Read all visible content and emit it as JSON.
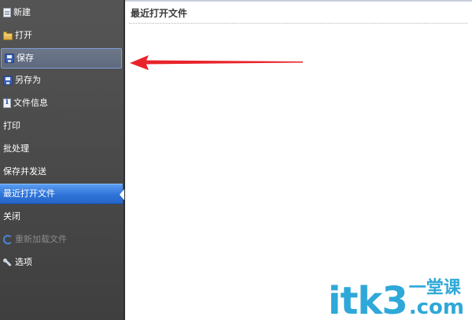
{
  "sidebar": {
    "items": [
      {
        "label": "新建",
        "icon": "new-document-icon",
        "state": "normal"
      },
      {
        "label": "打开",
        "icon": "folder-open-icon",
        "state": "normal"
      },
      {
        "label": "保存",
        "icon": "save-disk-icon",
        "state": "hover"
      },
      {
        "label": "另存为",
        "icon": "save-as-disk-icon",
        "state": "normal"
      },
      {
        "label": "文件信息",
        "icon": "file-info-icon",
        "state": "normal"
      },
      {
        "label": "打印",
        "state": "normal"
      },
      {
        "label": "批处理",
        "state": "normal"
      },
      {
        "label": "保存并发送",
        "state": "normal"
      },
      {
        "label": "最近打开文件",
        "state": "active"
      },
      {
        "label": "关闭",
        "state": "normal"
      },
      {
        "label": "重新加载文件",
        "icon": "reload-icon",
        "state": "disabled"
      },
      {
        "label": "选项",
        "icon": "tools-icon",
        "state": "normal"
      }
    ]
  },
  "main": {
    "title": "最近打开文件"
  },
  "watermark": {
    "logo": "itk3",
    "cn": "一堂课",
    "com": ".com"
  },
  "colors": {
    "sidebar_bg": "#4c4c4c",
    "active_blue": "#2f74d8",
    "arrow_red": "#e8242a",
    "watermark_blue": "#2ea8d8"
  }
}
